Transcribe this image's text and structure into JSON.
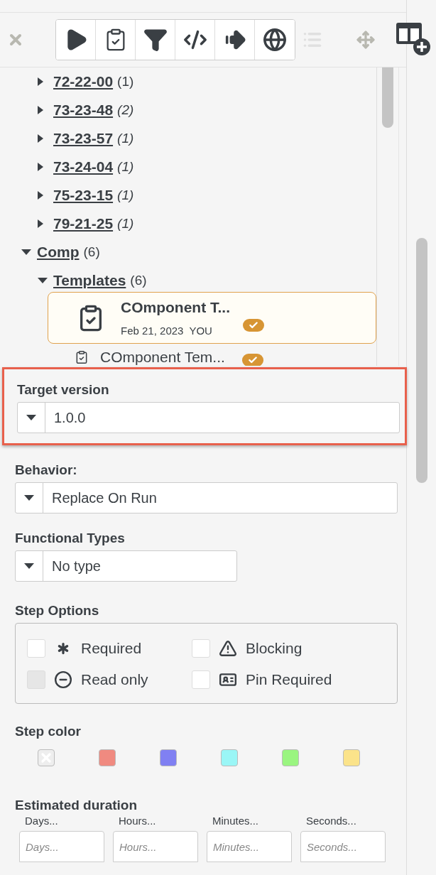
{
  "toolbar": {
    "buttons": [
      {
        "kind": "play"
      },
      {
        "kind": "checklist"
      },
      {
        "kind": "filter"
      },
      {
        "kind": "code"
      },
      {
        "kind": "forward"
      },
      {
        "kind": "globe"
      }
    ],
    "list_disabled": true
  },
  "tree": [
    {
      "children": [
        {
          "label": "72-22-00",
          "count": "(1)",
          "italic": false,
          "expanded": false
        },
        {
          "label": "73-23-48",
          "count": "(2)",
          "italic": true,
          "expanded": false
        },
        {
          "label": "73-23-57",
          "count": "(1)",
          "italic": true,
          "expanded": false
        },
        {
          "label": "73-24-04",
          "count": "(1)",
          "italic": true,
          "expanded": false
        },
        {
          "label": "75-23-15",
          "count": "(1)",
          "italic": true,
          "expanded": false
        },
        {
          "label": "79-21-25",
          "count": "(1)",
          "italic": true,
          "expanded": false
        }
      ]
    },
    {
      "label": "Comp",
      "count": "(6)",
      "italic": false,
      "expanded": true,
      "children": [
        {
          "label": "Templates",
          "count": "(6)",
          "italic": false,
          "expanded": true,
          "files": [
            {
              "title": "COmponent T...",
              "date": "Feb 21, 2023",
              "user": "YOU",
              "selected": true
            },
            {
              "title": "COmponent Tem...",
              "selected": false
            }
          ]
        }
      ]
    }
  ],
  "fields": [
    {
      "label": "Target version",
      "value": "1.0.0",
      "highlighted": true,
      "wide": true
    },
    {
      "label": "Behavior:",
      "value": "Replace On Run",
      "highlighted": false,
      "wide": true
    },
    {
      "label": "Functional Types",
      "value": "No type",
      "highlighted": false,
      "wide": false
    }
  ],
  "step_options": {
    "title": "Step Options",
    "options": [
      {
        "kind": "asterisk",
        "label": "Required",
        "checked": false,
        "disabled": false
      },
      {
        "kind": "warning",
        "label": "Blocking",
        "checked": false,
        "disabled": false
      },
      {
        "kind": "minus",
        "label": "Read only",
        "checked": false,
        "disabled": true
      },
      {
        "kind": "id-card",
        "label": "Pin Required",
        "checked": false,
        "disabled": false
      }
    ]
  },
  "step_color": {
    "title": "Step color",
    "swatches": [
      {
        "kind": "none",
        "color": "#eeeeee"
      },
      {
        "kind": "color",
        "color": "#f08a80"
      },
      {
        "kind": "color",
        "color": "#8080f2"
      },
      {
        "kind": "color",
        "color": "#9af6f6"
      },
      {
        "kind": "color",
        "color": "#9af580"
      },
      {
        "kind": "color",
        "color": "#fbe38a"
      }
    ]
  },
  "duration": {
    "title": "Estimated duration",
    "fields": [
      {
        "label": "Days...",
        "placeholder": "Days..."
      },
      {
        "label": "Hours...",
        "placeholder": "Hours..."
      },
      {
        "label": "Minutes...",
        "placeholder": "Minutes..."
      },
      {
        "label": "Seconds...",
        "placeholder": "Seconds..."
      }
    ]
  }
}
